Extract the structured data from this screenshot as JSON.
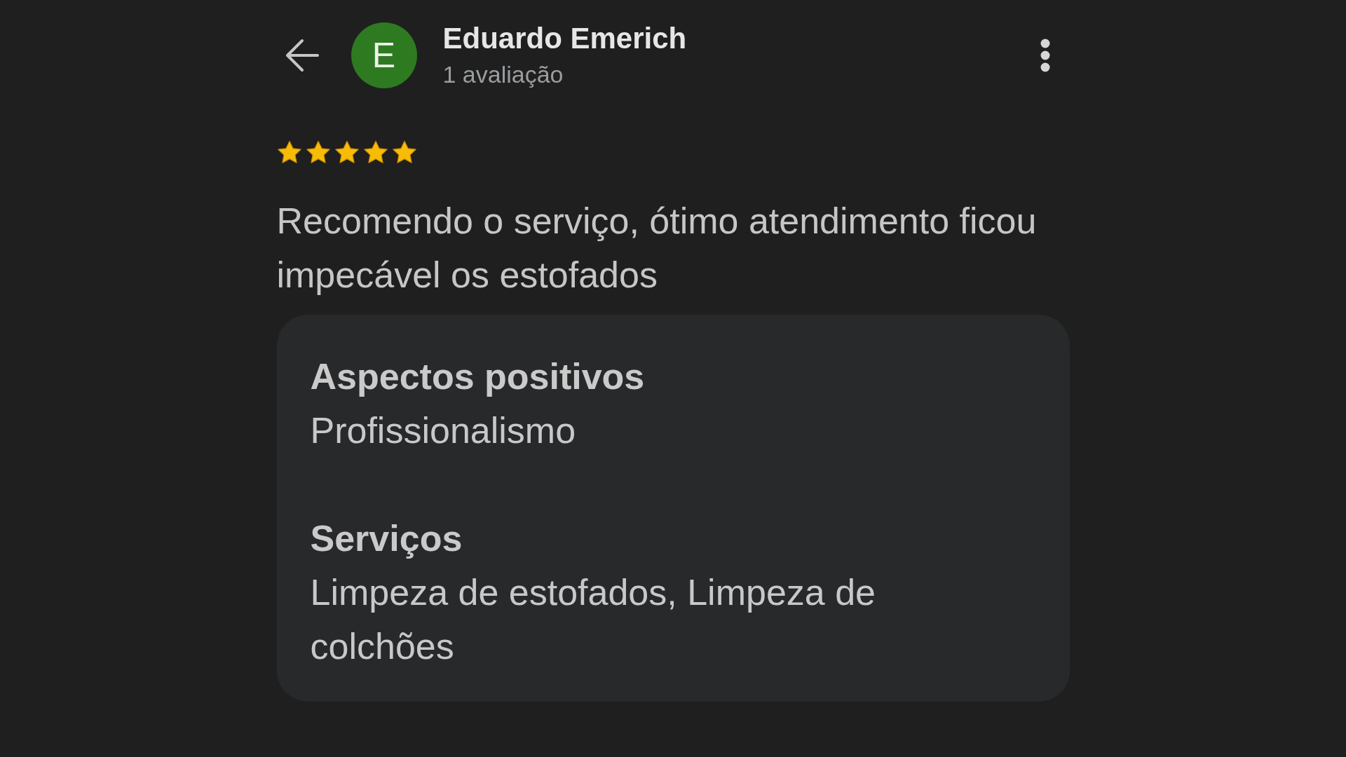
{
  "reviewer": {
    "initial": "E",
    "name": "Eduardo Emerich",
    "review_count": "1 avaliação"
  },
  "review": {
    "stars": 5,
    "text": "Recomendo o serviço, ótimo atendimento ficou impecável os estofados"
  },
  "details": [
    {
      "heading": "Aspectos positivos",
      "value": "Profissionalismo"
    },
    {
      "heading": "Serviços",
      "value": "Limpeza de estofados, Limpeza de colchões"
    }
  ]
}
